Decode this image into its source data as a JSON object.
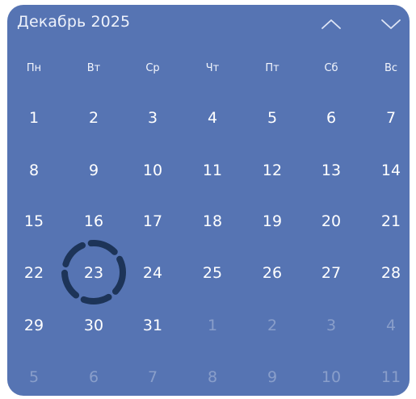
{
  "calendar": {
    "month_title": "Декабрь 2025",
    "prev_icon": "chevron-up-icon",
    "next_icon": "chevron-down-icon",
    "weekdays": [
      "Пн",
      "Вт",
      "Ср",
      "Чт",
      "Пт",
      "Сб",
      "Вс"
    ],
    "weeks": [
      [
        "1",
        "2",
        "3",
        "4",
        "5",
        "6",
        "7"
      ],
      [
        "8",
        "9",
        "10",
        "11",
        "12",
        "13",
        "14"
      ],
      [
        "15",
        "16",
        "17",
        "18",
        "19",
        "20",
        "21"
      ],
      [
        "22",
        "23",
        "24",
        "25",
        "26",
        "27",
        "28"
      ],
      [
        "29",
        "30",
        "31",
        "1",
        "2",
        "3",
        "4"
      ],
      [
        "5",
        "6",
        "7",
        "8",
        "9",
        "10",
        "11"
      ]
    ],
    "today": "23",
    "colors": {
      "background": "#5674b3",
      "text": "#ffffff",
      "today_ring": "#1d3458"
    }
  }
}
